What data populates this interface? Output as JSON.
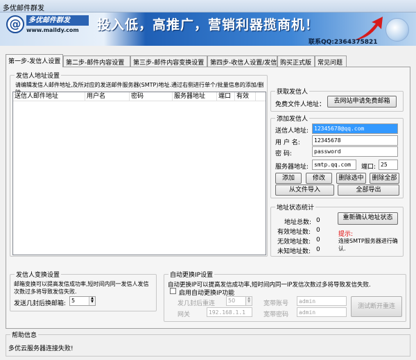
{
  "window": {
    "title": "多优邮件群发"
  },
  "banner": {
    "logo_glyph": "@",
    "brand": "多优邮件群发",
    "url": "www.maildy.com",
    "slogan": "投入低，高推广，营销利器揽商机！",
    "contact": "联系QQ:2364375821"
  },
  "tabs": [
    {
      "label": "第一步-发信人设置"
    },
    {
      "label": "第二步-邮件内容设置"
    },
    {
      "label": "第三步-邮件内容变换设置"
    },
    {
      "label": "第四步-收信人设置/发信"
    },
    {
      "label": "购买正式版"
    },
    {
      "label": "常见问题"
    }
  ],
  "sender_list": {
    "title": "发信人地址设置",
    "instruction": "请编辑发信人邮件地址,及所对应的发送邮件服务器(SMTP)地址.通过右侧进行单个/批量信息的添加/删除.",
    "columns": [
      "送信人邮件地址",
      "用户名",
      "密码",
      "服务器地址",
      "端口",
      "有效"
    ]
  },
  "get_sender": {
    "title": "获取发信人",
    "label": "免费文件人地址：",
    "button": "去网站申请免费邮箱"
  },
  "add_sender": {
    "title": "添加发信人",
    "address_label": "送信人地址:",
    "address_value": "12345678@qq.com",
    "user_label": "用 户 名:",
    "user_value": "12345678",
    "password_label": "密   码:",
    "password_value": "password",
    "server_label": "服务器地址:",
    "server_value": "smtp.qq.com",
    "port_label": "端口:",
    "port_value": "25",
    "add_button": "添加",
    "edit_button": "修改",
    "delete_selected_button": "删除选中",
    "delete_all_button": "删除全部",
    "import_button": "从文件导入",
    "export_button": "全部导出"
  },
  "stats": {
    "title": "地址状态统计",
    "total_label": "地址总数:",
    "total_value": "0",
    "valid_label": "有效地址数:",
    "valid_value": "0",
    "invalid_label": "无效地址数:",
    "invalid_value": "0",
    "unknown_label": "未知地址数:",
    "unknown_value": "0",
    "reconfirm_button": "重新确认地址状态",
    "hint_title": "提示:",
    "hint_text": "连接SMTP服务器进行确认."
  },
  "sender_switch": {
    "title": "发信人变换设置",
    "text": "邮箱变换可以提高发信成功率,短时间内同一发信人发信次数过多将导致发信失败.",
    "label": "发送几封后换邮箱:",
    "value": "5"
  },
  "ip_switch": {
    "title": "自动更换IP设置",
    "text": "自动更换IP可以提高发信成功率,短时间内同一IP发信次数过多将导致发信失败.",
    "checkbox_label": "启用自动更换IP功能",
    "reconnect_label": "发几封后重连",
    "reconnect_value": "50",
    "broadband_account_label": "宽带账号",
    "broadband_account_value": "admin",
    "gateway_label": "网关",
    "gateway_value": "192.168.1.1",
    "broadband_password_label": "宽带密码",
    "broadband_password_value": "admin",
    "test_button": "测试断开重连"
  },
  "help": {
    "title": "帮助信息",
    "message": "多优云服务器连接失败!"
  }
}
